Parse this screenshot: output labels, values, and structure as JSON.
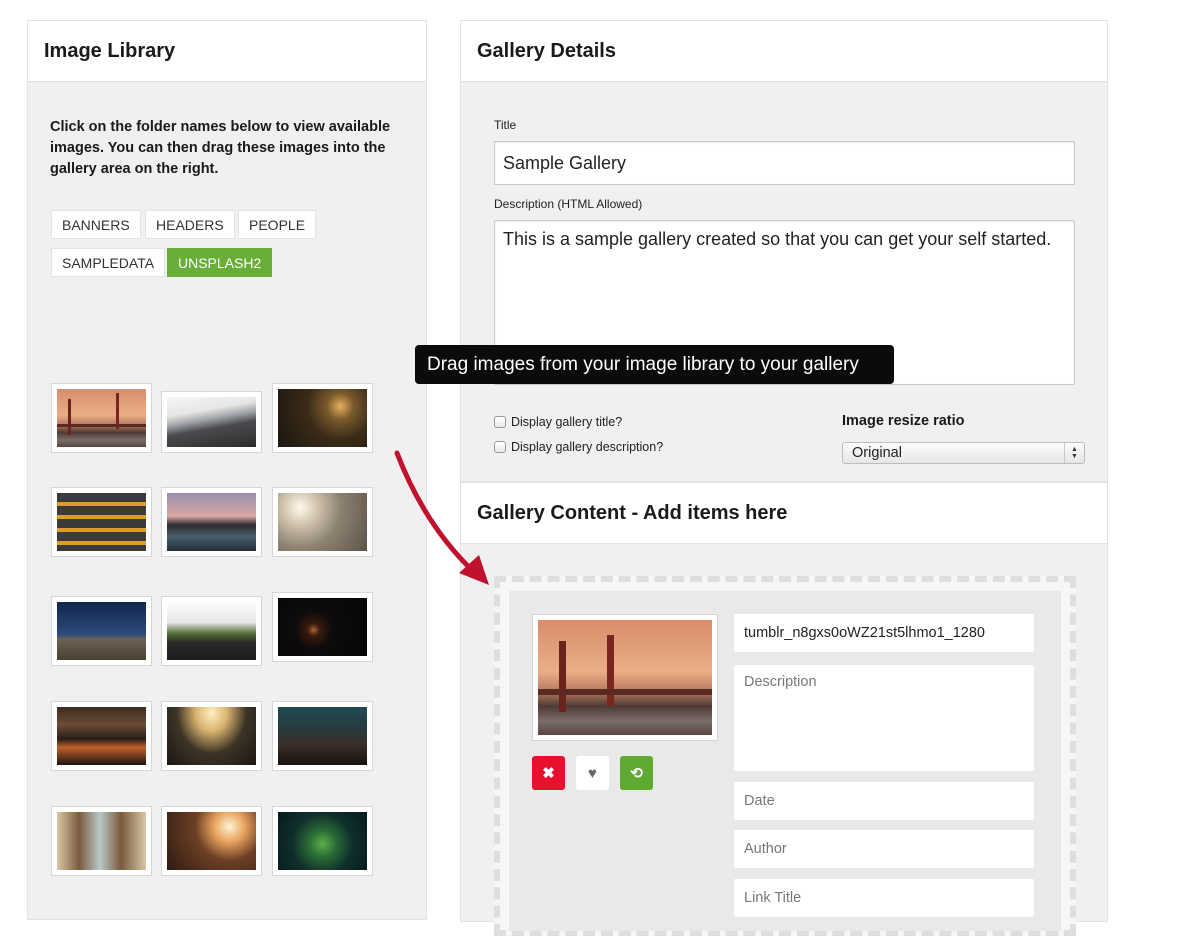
{
  "library": {
    "title": "Image Library",
    "intro": "Click on the folder names below to view available images. You can then drag these images into the gallery area on the right.",
    "folders": [
      {
        "label": "BANNERS",
        "active": false
      },
      {
        "label": "HEADERS",
        "active": false
      },
      {
        "label": "PEOPLE",
        "active": false
      },
      {
        "label": "SAMPLEDATA",
        "active": false
      },
      {
        "label": "UNSPLASH2",
        "active": true
      }
    ],
    "active_color": "#6aae3a",
    "images": [
      "golden-gate-bridge",
      "mountain-above-clouds",
      "sunlit-grass",
      "yellow-striped-stairs",
      "person-jumping-pier",
      "foggy-sky-birds",
      "desert-road-night",
      "green-mountain-snow",
      "hand-in-darkness",
      "crowded-bar",
      "moving-walkway-tunnel",
      "coastal-town-dusk",
      "narrow-street-balconies",
      "silhouette-at-sunset",
      "green-leaves-flower"
    ]
  },
  "details": {
    "title": "Gallery Details",
    "title_label": "Title",
    "title_value": "Sample Gallery",
    "description_label": "Description (HTML Allowed)",
    "description_value": "This is a sample gallery created so that you can get your self started.",
    "checkbox_title": "Display gallery title?",
    "checkbox_description": "Display gallery description?",
    "resize_label": "Image resize ratio",
    "resize_value": "Original"
  },
  "tooltip": {
    "text": "Drag images from your image library to your gallery"
  },
  "content": {
    "title": "Gallery Content - Add items here",
    "item": {
      "image": "golden-gate-bridge",
      "filename": "tumblr_n8gxs0oWZ21st5lhmo1_1280",
      "description_placeholder": "Description",
      "date_placeholder": "Date",
      "author_placeholder": "Author",
      "link_title_placeholder": "Link Title"
    },
    "actions": {
      "delete_color": "#e8112d",
      "favorite_color": "#ffffff",
      "replace_color": "#5fa832"
    }
  },
  "arrow_color": "#c0122f"
}
